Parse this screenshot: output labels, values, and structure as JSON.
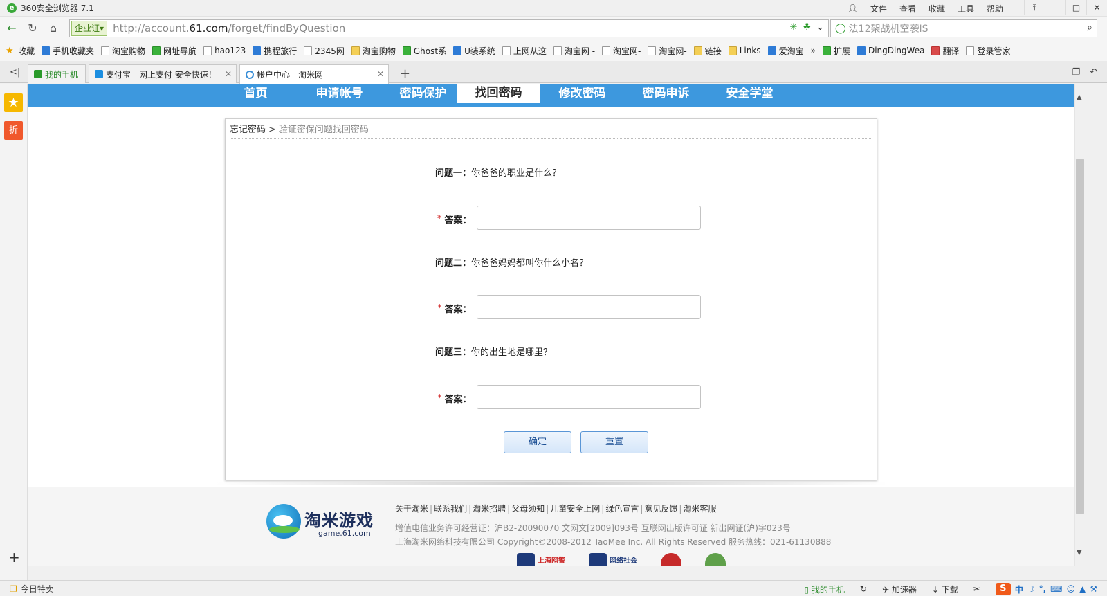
{
  "browser": {
    "title": "360安全浏览器 7.1",
    "menu": [
      "文件",
      "查看",
      "收藏",
      "工具",
      "帮助"
    ],
    "url_cert": "企业",
    "url_cert_badge": "证",
    "url_prefix": "http://account.",
    "url_domain": "61.com",
    "url_path": "/forget/findByQuestion",
    "search_text": "法12架战机空袭IS"
  },
  "bookmarks": [
    {
      "label": "收藏",
      "icon": "star"
    },
    {
      "label": "手机收藏夹",
      "icon": "blue"
    },
    {
      "label": "淘宝购物",
      "icon": "page"
    },
    {
      "label": "网址导航",
      "icon": "green"
    },
    {
      "label": "hao123",
      "icon": "page"
    },
    {
      "label": "携程旅行",
      "icon": "blue"
    },
    {
      "label": "2345网",
      "icon": "page"
    },
    {
      "label": "淘宝购物",
      "icon": "folder"
    },
    {
      "label": "Ghost系",
      "icon": "green"
    },
    {
      "label": "U装系统",
      "icon": "blue"
    },
    {
      "label": "上网从这",
      "icon": "page"
    },
    {
      "label": "淘宝网 -",
      "icon": "page"
    },
    {
      "label": "淘宝网-",
      "icon": "page"
    },
    {
      "label": "淘宝网-",
      "icon": "page"
    },
    {
      "label": "链接",
      "icon": "folder"
    },
    {
      "label": "Links",
      "icon": "folder"
    },
    {
      "label": "爱淘宝",
      "icon": "blue"
    },
    {
      "label": "»",
      "icon": "none"
    },
    {
      "label": "扩展",
      "icon": "green"
    },
    {
      "label": "DingDingWea",
      "icon": "blue"
    },
    {
      "label": "翻译",
      "icon": "red"
    },
    {
      "label": "登录管家",
      "icon": "page"
    }
  ],
  "tabs": [
    {
      "label": "我的手机"
    },
    {
      "label": "支付宝 - 网上支付 安全快速！"
    },
    {
      "label": "帐户中心 - 淘米网"
    }
  ],
  "sidebar": {
    "fav_icon": "★",
    "deal_label": "折",
    "add_icon": "+"
  },
  "site_nav": [
    "首页",
    "申请帐号",
    "密码保护",
    "找回密码",
    "修改密码",
    "密码申诉",
    "安全学堂"
  ],
  "breadcrumb": {
    "root": "忘记密码",
    "sep": ">",
    "current": "验证密保问题找回密码"
  },
  "form": {
    "questions": [
      {
        "label": "问题一：",
        "text": "你爸爸的职业是什么？"
      },
      {
        "label": "问题二：",
        "text": "你爸爸妈妈都叫你什么小名？"
      },
      {
        "label": "问题三：",
        "text": "你的出生地是哪里？"
      }
    ],
    "required_mark": "*",
    "answer_label": "答案：",
    "answers": [
      "",
      "",
      ""
    ],
    "confirm": "确定",
    "reset": "重置"
  },
  "footer": {
    "logo_name": "淘米游戏",
    "logo_sub": "game.61.com",
    "links": [
      "关于淘米",
      "联系我们",
      "淘米招聘",
      "父母须知",
      "儿童安全上网",
      "绿色宣言",
      "意见反馈",
      "淘米客服"
    ],
    "license": "增值电信业务许可经营证：沪B2-20090070   文网文[2009]093号   互联网出版许可证 新出网证(沪)字023号",
    "copyright": "上海淘米网络科技有限公司 Copyright©2008-2012 TaoMee Inc. All Rights Reserved  服务热线：021-61130888",
    "badges": [
      "上海网警",
      "网络社会"
    ]
  },
  "statusbar": {
    "deals": "今日特卖",
    "phone": "我的手机",
    "accelerator": "加速器",
    "download": "下载",
    "ime": "中"
  }
}
